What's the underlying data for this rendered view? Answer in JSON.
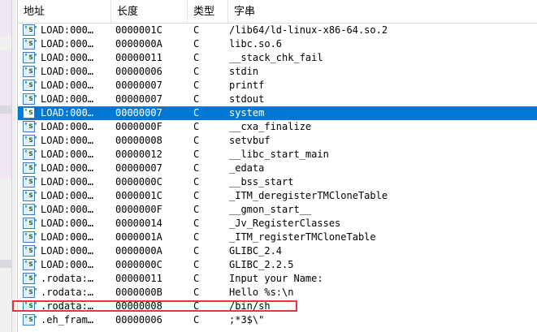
{
  "columns": {
    "address": "地址",
    "length": "长度",
    "type": "类型",
    "string": "字串"
  },
  "icon_glyph": "'s'",
  "selected_row": 6,
  "highlight_color": "#e8363a",
  "selection_color": "#0078d7",
  "rows": [
    {
      "address": "LOAD:000…",
      "length": "0000001C",
      "type": "C",
      "string": "/lib64/ld-linux-x86-64.so.2"
    },
    {
      "address": "LOAD:000…",
      "length": "0000000A",
      "type": "C",
      "string": "libc.so.6"
    },
    {
      "address": "LOAD:000…",
      "length": "00000011",
      "type": "C",
      "string": "__stack_chk_fail"
    },
    {
      "address": "LOAD:000…",
      "length": "00000006",
      "type": "C",
      "string": "stdin"
    },
    {
      "address": "LOAD:000…",
      "length": "00000007",
      "type": "C",
      "string": "printf"
    },
    {
      "address": "LOAD:000…",
      "length": "00000007",
      "type": "C",
      "string": "stdout"
    },
    {
      "address": "LOAD:000…",
      "length": "00000007",
      "type": "C",
      "string": "system"
    },
    {
      "address": "LOAD:000…",
      "length": "0000000F",
      "type": "C",
      "string": "__cxa_finalize"
    },
    {
      "address": "LOAD:000…",
      "length": "00000008",
      "type": "C",
      "string": "setvbuf"
    },
    {
      "address": "LOAD:000…",
      "length": "00000012",
      "type": "C",
      "string": "__libc_start_main"
    },
    {
      "address": "LOAD:000…",
      "length": "00000007",
      "type": "C",
      "string": "_edata"
    },
    {
      "address": "LOAD:000…",
      "length": "0000000C",
      "type": "C",
      "string": "__bss_start"
    },
    {
      "address": "LOAD:000…",
      "length": "0000001C",
      "type": "C",
      "string": "_ITM_deregisterTMCloneTable"
    },
    {
      "address": "LOAD:000…",
      "length": "0000000F",
      "type": "C",
      "string": "__gmon_start__"
    },
    {
      "address": "LOAD:000…",
      "length": "00000014",
      "type": "C",
      "string": "_Jv_RegisterClasses"
    },
    {
      "address": "LOAD:000…",
      "length": "0000001A",
      "type": "C",
      "string": "_ITM_registerTMCloneTable"
    },
    {
      "address": "LOAD:000…",
      "length": "0000000A",
      "type": "C",
      "string": "GLIBC_2.4"
    },
    {
      "address": "LOAD:000…",
      "length": "0000000C",
      "type": "C",
      "string": "GLIBC_2.2.5"
    },
    {
      "address": ".rodata:…",
      "length": "00000011",
      "type": "C",
      "string": "Input your Name:"
    },
    {
      "address": ".rodata:…",
      "length": "0000000B",
      "type": "C",
      "string": "Hello %s:\\n"
    },
    {
      "address": ".rodata:…",
      "length": "00000008",
      "type": "C",
      "string": "/bin/sh"
    },
    {
      "address": ".eh_fram…",
      "length": "00000006",
      "type": "C",
      "string": ";*3$\\\""
    }
  ]
}
